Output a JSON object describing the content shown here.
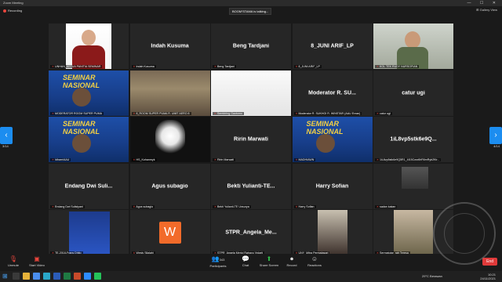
{
  "window": {
    "title": "Zoom Meeting",
    "controls": "— ☐ ✕"
  },
  "recording_label": "Recording",
  "talking_label": "BOOM'STAMA is talking...",
  "view_label": "⊞ Gallery View",
  "pagination": {
    "left": "3/14",
    "right": "4/14"
  },
  "tiles": [
    {
      "label": "UNHAN_KETUA PANITIA SEMINAR",
      "kind": "portrait"
    },
    {
      "label": "Indah Kusuma",
      "center": "Indah Kusuma",
      "kind": "name"
    },
    {
      "label": "Beng Tardjani",
      "center": "Beng Tardjani",
      "kind": "name"
    },
    {
      "label": "8_JUNI ARIF_LP",
      "center": "8_JUNI ARIF_LP",
      "kind": "name"
    },
    {
      "label": "KOL TEK RUDY NURSOFIAN",
      "kind": "camroom"
    },
    {
      "label": "MODERATOR ROOM SUPER PUMA",
      "kind": "seminar"
    },
    {
      "label": "8_ROOM SUPER PUMA R. UMIT AERO 8",
      "kind": "room"
    },
    {
      "label": "Sembiring Gaotomo",
      "kind": "whitecam"
    },
    {
      "label": "Moderator R. SUKHOI R. WINSTAR (AAU Evran)",
      "center": "Moderator R. SU...",
      "kind": "name"
    },
    {
      "label": "catur ugi",
      "center": "catur ugi",
      "kind": "name"
    },
    {
      "label": "Idham/AAU",
      "kind": "seminar"
    },
    {
      "label": "HS_Kohanmyk",
      "kind": "garuda"
    },
    {
      "label": "Ririn Marwati",
      "center": "Ririn Marwati",
      "kind": "name"
    },
    {
      "label": "MADHIAWN",
      "kind": "seminar"
    },
    {
      "label": "1iL8vp5stk6e9Q5R1_4I15Cosr6hR6mRyb2Kir...",
      "center": "1iL8vp5stk6e9Q...",
      "kind": "name"
    },
    {
      "label": "Endang Dwi Sulistyani",
      "center": "Endang Dwi Suli...",
      "kind": "name"
    },
    {
      "label": "Agus subagio",
      "center": "Agus subagio",
      "kind": "name"
    },
    {
      "label": "Bekti Yulianti-TE Unsurya",
      "center": "Bekti Yulianti-TE...",
      "kind": "name"
    },
    {
      "label": "Harry Sofian",
      "center": "Harry Sofian",
      "kind": "name"
    },
    {
      "label": "sadan kakan",
      "kind": "smallcam"
    },
    {
      "label": "TE-2018-Frans Dhito",
      "kind": "police"
    },
    {
      "label": "Wesly Silalahi",
      "avatar": "W",
      "kind": "avatar"
    },
    {
      "label": "STPR_Angela Merici Rahayu Vrdarti",
      "center": "STPR_Angela_Me...",
      "kind": "name"
    },
    {
      "label": "UNY_Mitra Permatasari",
      "kind": "hijab"
    },
    {
      "label": "Sermatutar_rah Teresa",
      "kind": "uniform"
    }
  ],
  "toolbar": {
    "unmute": "Unmute",
    "start_video": "Start Video",
    "participants": "Participants",
    "participants_count": "343",
    "chat": "Chat",
    "share_screen": "Share Screen",
    "record": "Record",
    "reactions": "Reactions",
    "end": "End"
  },
  "taskbar": {
    "weather": "29°C Berawan",
    "time": "10:21",
    "date": "24/11/2021"
  },
  "watermark_text": "UNIVERSITAS PERTAHANAN REPUBLIK INDONESIA"
}
